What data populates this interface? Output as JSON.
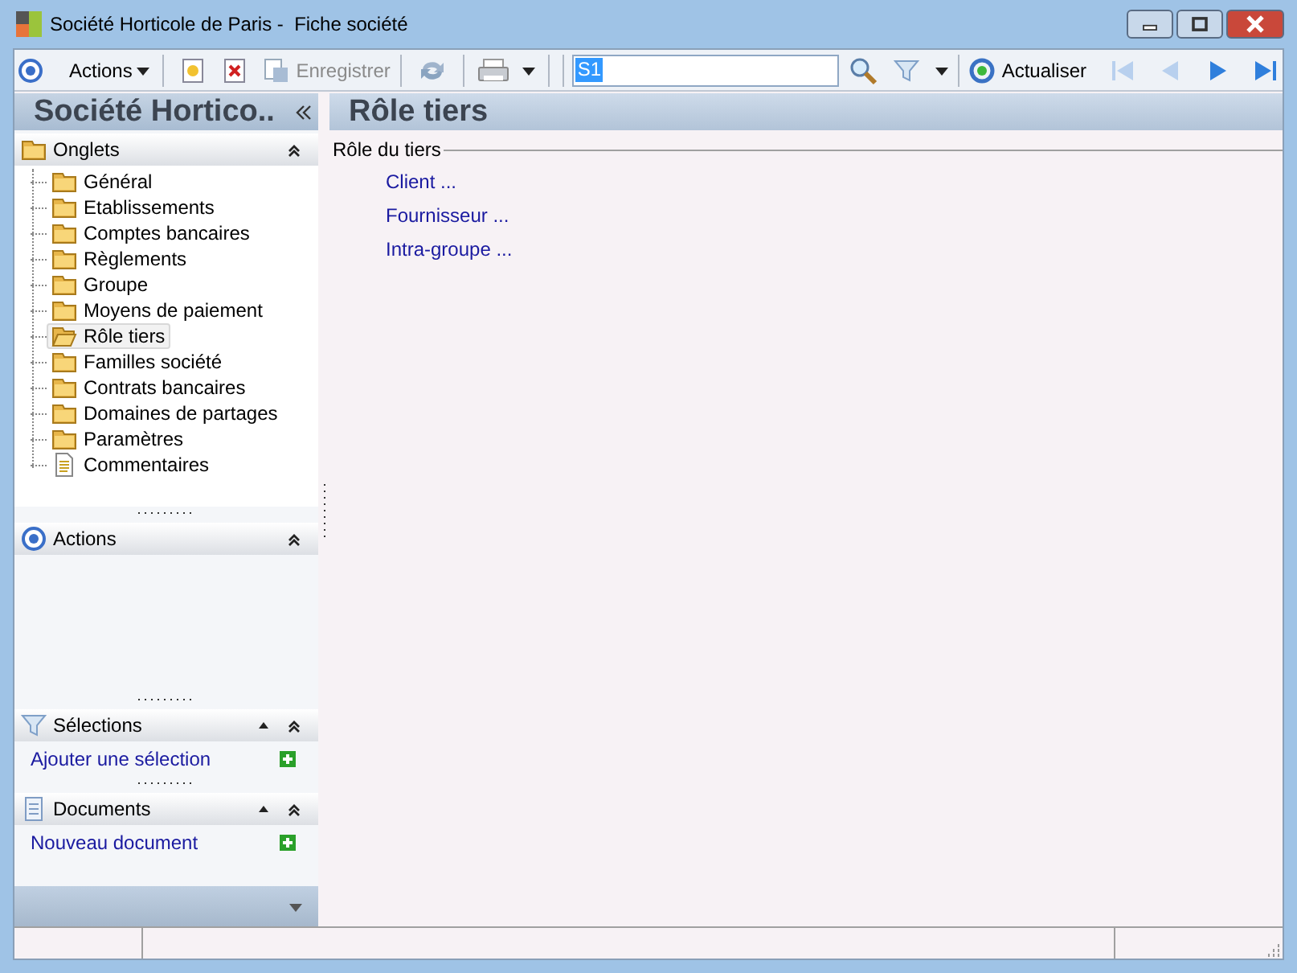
{
  "window": {
    "title": "Société Horticole de Paris -  Fiche société"
  },
  "toolbar": {
    "actions_menu": "Actions",
    "save": {
      "label": "Enregistrer",
      "disabled": true
    },
    "search": {
      "value": "S1"
    },
    "refresh": "Actualiser",
    "nav": [
      {
        "kind": "first",
        "disabled": true
      },
      {
        "kind": "prev",
        "disabled": true
      },
      {
        "kind": "next",
        "disabled": false
      },
      {
        "kind": "last",
        "disabled": false
      }
    ]
  },
  "sidebar": {
    "title": "Société Hortico..",
    "sections": [
      {
        "kind": "tabs",
        "title": "Onglets",
        "items": [
          {
            "kind": "folder",
            "label": "Général",
            "selected": false
          },
          {
            "kind": "folder",
            "label": "Etablissements",
            "selected": false
          },
          {
            "kind": "folder",
            "label": "Comptes bancaires",
            "selected": false
          },
          {
            "kind": "folder",
            "label": "Règlements",
            "selected": false
          },
          {
            "kind": "folder",
            "label": "Groupe",
            "selected": false
          },
          {
            "kind": "folder",
            "label": "Moyens de paiement",
            "selected": false
          },
          {
            "kind": "folder",
            "label": "Rôle tiers",
            "selected": true
          },
          {
            "kind": "folder",
            "label": "Familles société",
            "selected": false
          },
          {
            "kind": "folder",
            "label": "Contrats bancaires",
            "selected": false
          },
          {
            "kind": "folder",
            "label": "Domaines de partages",
            "selected": false
          },
          {
            "kind": "folder",
            "label": "Paramètres",
            "selected": false
          },
          {
            "kind": "document",
            "label": "Commentaires",
            "selected": false
          }
        ]
      },
      {
        "kind": "actions",
        "title": "Actions"
      },
      {
        "kind": "selections",
        "title": "Sélections",
        "link": "Ajouter une sélection"
      },
      {
        "kind": "documents",
        "title": "Documents",
        "link": "Nouveau document"
      }
    ]
  },
  "main": {
    "title": "Rôle tiers",
    "group": {
      "legend": "Rôle du tiers",
      "links": [
        "Client ...",
        "Fournisseur ...",
        "Intra-groupe ..."
      ]
    }
  }
}
